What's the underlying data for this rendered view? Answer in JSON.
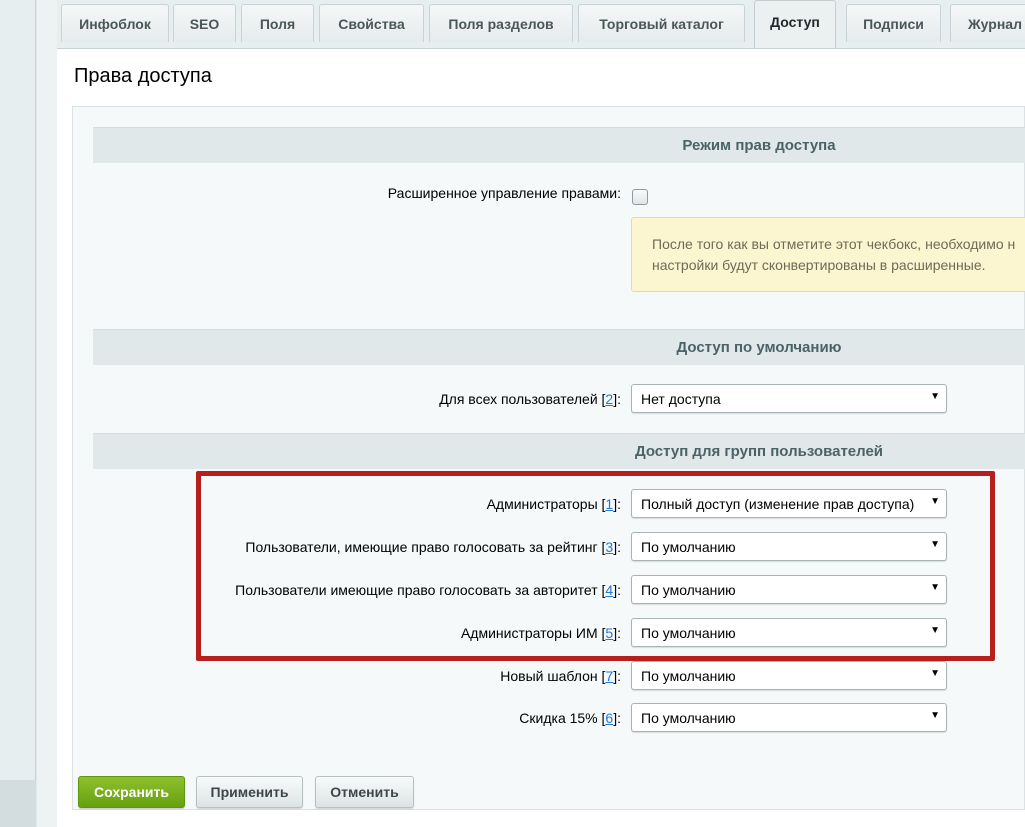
{
  "tabs": [
    {
      "label": "Инфоблок"
    },
    {
      "label": "SEO"
    },
    {
      "label": "Поля"
    },
    {
      "label": "Свойства"
    },
    {
      "label": "Поля разделов"
    },
    {
      "label": "Торговый каталог"
    },
    {
      "label": "Доступ",
      "active": true
    },
    {
      "label": "Подписи"
    },
    {
      "label": "Журнал"
    }
  ],
  "page": {
    "title": "Права доступа"
  },
  "mode_section": {
    "title": "Режим прав доступа",
    "extended_label": "Расширенное управление правами:",
    "extended_checked": false,
    "note_line1": "После того как вы отметите этот чекбокс, необходимо н",
    "note_line2": "настройки будут сконвертированы в расширенные."
  },
  "default_section": {
    "title": "Доступ по умолчанию",
    "rows": [
      {
        "label": "Для всех пользователей",
        "id": "2",
        "value": "Нет доступа"
      }
    ]
  },
  "groups_section": {
    "title": "Доступ для групп пользователей",
    "rows": [
      {
        "label": "Администраторы",
        "id": "1",
        "value": "Полный доступ (изменение прав доступа)"
      },
      {
        "label": "Пользователи, имеющие право голосовать за рейтинг",
        "id": "3",
        "value": "По умолчанию"
      },
      {
        "label": "Пользователи имеющие право голосовать за авторитет",
        "id": "4",
        "value": "По умолчанию"
      },
      {
        "label": "Администраторы ИМ",
        "id": "5",
        "value": "По умолчанию"
      },
      {
        "label": "Новый шаблон",
        "id": "7",
        "value": "По умолчанию"
      },
      {
        "label": "Скидка 15%",
        "id": "6",
        "value": "По умолчанию"
      }
    ]
  },
  "punct": {
    "open": " [",
    "close": "]:",
    "colon": ":"
  },
  "select_arrow": "▼",
  "buttons": {
    "save": "Сохранить",
    "apply": "Применить",
    "cancel": "Отменить"
  },
  "colors": {
    "highlight": "#b5201c",
    "save": "#76ad1c",
    "link": "#2675d7"
  }
}
